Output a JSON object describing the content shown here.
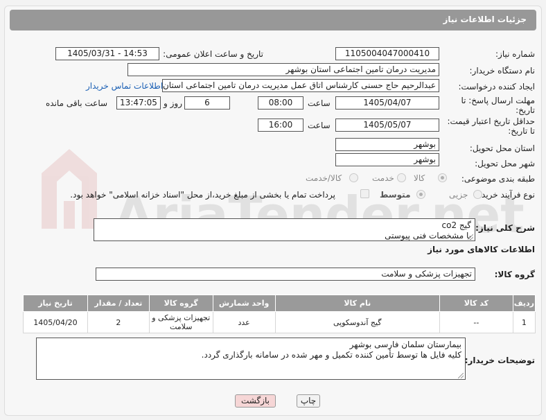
{
  "header": {
    "title": "جزئیات اطلاعات نیاز"
  },
  "fields": {
    "need_number_label": "شماره نیاز:",
    "need_number": "1105004047000410",
    "announce_label": "تاریخ و ساعت اعلان عمومی:",
    "announce_value": "1405/03/31 - 14:53",
    "buyer_org_label": "نام دستگاه خریدار:",
    "buyer_org": "مدیریت درمان تامین اجتماعی استان بوشهر",
    "creator_label": "ایجاد کننده درخواست:",
    "creator": "عبدالرحیم حاج حسنی کارشناس اتاق عمل مدیریت درمان تامین اجتماعی استان بوشهر",
    "contact_link": "اطلاعات تماس خریدار",
    "deadline_label_1": "مهلت ارسال پاسخ: تا",
    "deadline_label_2": "تاریخ:",
    "deadline_date": "1405/04/07",
    "time_label": "ساعت",
    "deadline_time": "08:00",
    "days_value": "6",
    "days_label": "روز و",
    "remaining_time": "13:47:05",
    "remaining_label": "ساعت باقی مانده",
    "validity_label_1": "حداقل تاریخ اعتبار قیمت:",
    "validity_label_2": "تا تاریخ:",
    "validity_date": "1405/05/07",
    "validity_time": "16:00",
    "province_label": "استان محل تحویل:",
    "province": "بوشهر",
    "city_label": "شهر محل تحویل:",
    "city": "بوشهر",
    "category_label": "طبقه بندی موضوعی:",
    "category_options": [
      "کالا",
      "خدمت",
      "کالا/خدمت"
    ],
    "process_label": "نوع فرآیند خرید :",
    "process_options": [
      "جزیی",
      "متوسط"
    ],
    "payment_note": "پرداخت تمام یا بخشی از مبلغ خرید،از محل \"اسناد خزانه اسلامی\" خواهد بود.",
    "description_label": "شرح کلی نیاز:",
    "description_lines": [
      "گیج co2",
      "با مشخصات فنی پیوستی"
    ],
    "goods_info_title": "اطلاعات کالاهای مورد نیاز",
    "goods_group_label": "گروه کالا:",
    "goods_group": "تجهیزات پزشکی و سلامت",
    "buyer_notes_label": "توضیحات خریدار:",
    "buyer_notes_lines": [
      "بیمارستان سلمان فارسی بوشهر",
      "کلیه فایل ها توسط تأمین کننده تکمیل و مهر شده در سامانه بارگذاری گردد."
    ]
  },
  "table": {
    "headers": [
      "ردیف",
      "کد کالا",
      "نام کالا",
      "واحد شمارش",
      "گروه کالا",
      "تعداد / مقدار",
      "تاریخ نیاز"
    ],
    "rows": [
      [
        "1",
        "--",
        "گیج آندوسکوپی",
        "عدد",
        "تجهیزات پزشکی و سلامت",
        "2",
        "1405/04/20"
      ]
    ]
  },
  "buttons": {
    "print": "چاپ",
    "back": "بازگشت"
  },
  "watermark": {
    "text": "AriaTender.net"
  },
  "colors": {
    "header": "#989898",
    "link": "#1a5fb4",
    "back_button": "#f6d6d6",
    "print_button": "#f2f2f2"
  }
}
